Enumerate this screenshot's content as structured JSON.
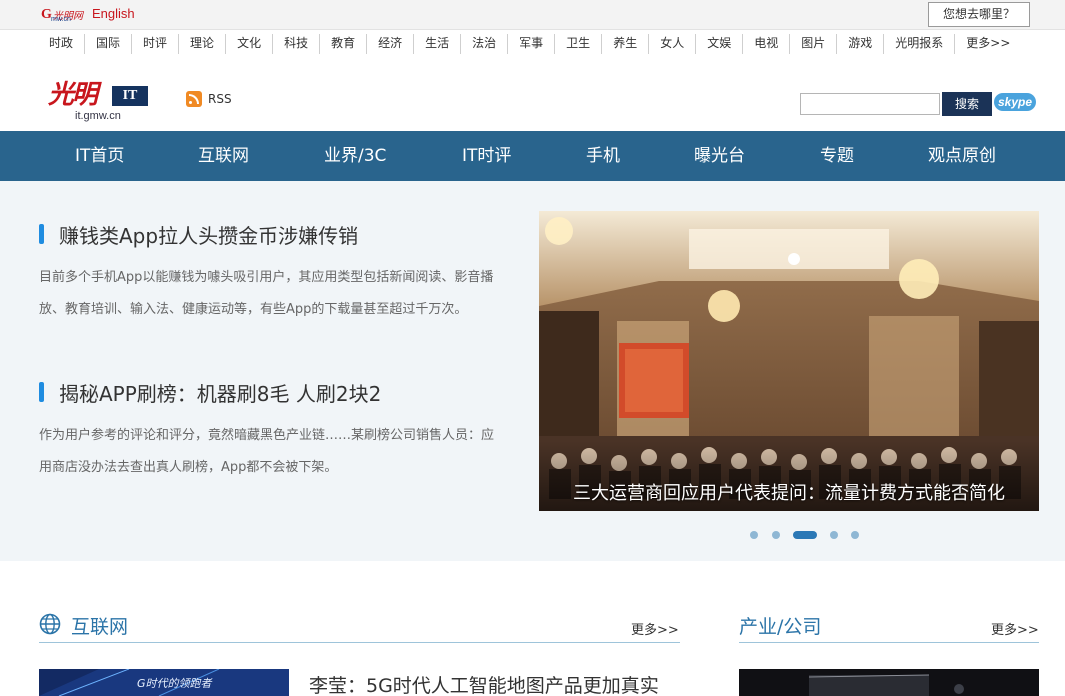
{
  "topbar": {
    "logo_text": "光明网",
    "language_link": "English",
    "where_button": "您想去哪里？"
  },
  "channels": [
    "时政",
    "国际",
    "时评",
    "理论",
    "文化",
    "科技",
    "教育",
    "经济",
    "生活",
    "法治",
    "军事",
    "卫生",
    "养生",
    "女人",
    "文娱",
    "电视",
    "图片",
    "游戏",
    "光明报系",
    "更多>>"
  ],
  "brand": {
    "logo_cn": "光明",
    "logo_it": "IT",
    "url": "it.gmw.cn",
    "rss_label": "RSS"
  },
  "search": {
    "placeholder": "",
    "button_label": "搜索",
    "skype_label": "skype"
  },
  "main_nav": [
    "IT首页",
    "互联网",
    "业界/3C",
    "IT时评",
    "手机",
    "曝光台",
    "专题",
    "观点原创"
  ],
  "headlines": [
    {
      "title": "赚钱类App拉人头攒金币涉嫌传销",
      "summary": "目前多个手机App以能赚钱为噱头吸引用户，其应用类型包括新闻阅读、影音播放、教育培训、输入法、健康运动等，有些App的下载量甚至超过千万次。"
    },
    {
      "title": "揭秘APP刷榜：机器刷8毛 人刷2块2",
      "summary": "作为用户参考的评论和评分，竟然暗藏黑色产业链……某刷榜公司销售人员：应用商店没办法去查出真人刷榜，App都不会被下架。"
    }
  ],
  "slideshow": {
    "caption": "三大运营商回应用户代表提问：流量计费方式能否简化",
    "total": 5,
    "active_index": 3
  },
  "sections": {
    "internet": {
      "title": "互联网",
      "more": "更多>>",
      "lead_title": "李莹：5G时代人工智能地图产品更加真实",
      "thumb_text": "G时代的领跑者"
    },
    "industry": {
      "title": "产业/公司",
      "more": "更多>>"
    }
  },
  "colors": {
    "nav_bg": "#29648d",
    "brand_red": "#c8161d",
    "accent_blue": "#1f8ce0",
    "section_blue": "#2b74a8",
    "hero_bg": "#f1f5f8"
  }
}
